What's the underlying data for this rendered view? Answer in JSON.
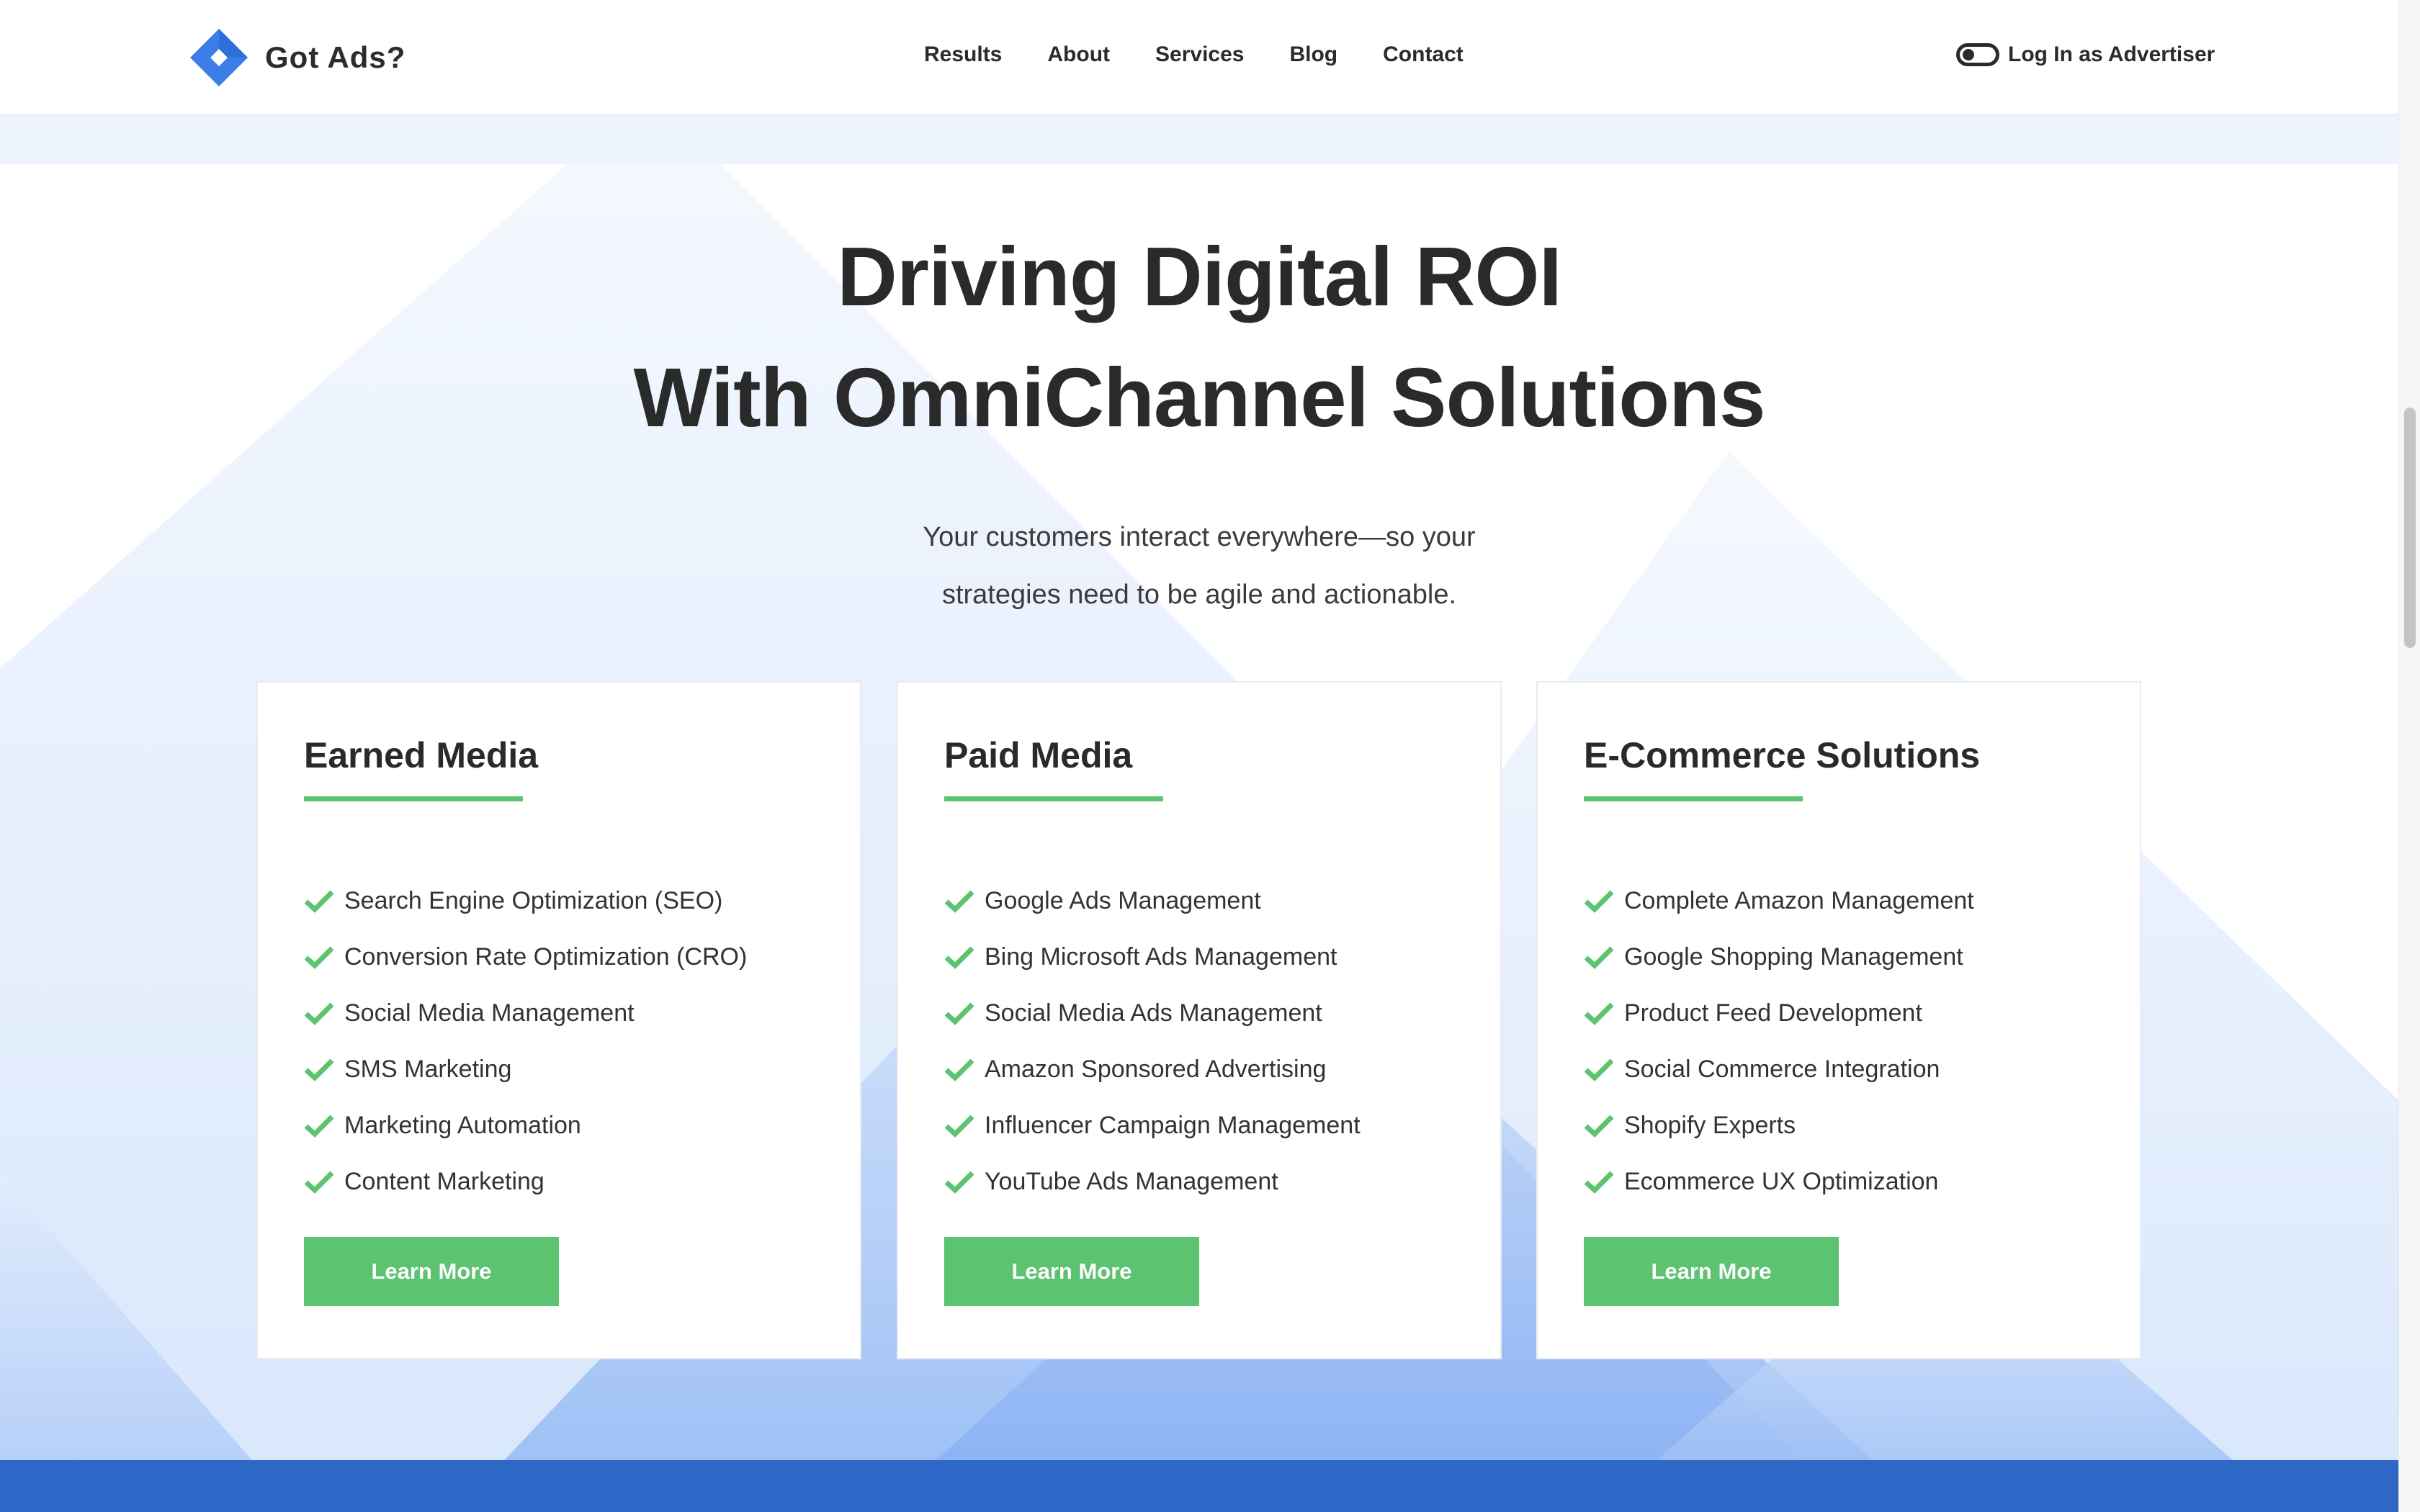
{
  "header": {
    "logo_text": "Got Ads?",
    "nav": [
      "Results",
      "About",
      "Services",
      "Blog",
      "Contact"
    ],
    "login_label": "Log In as Advertiser"
  },
  "hero": {
    "title_line1": "Driving Digital ROI",
    "title_line2": "With OmniChannel Solutions",
    "subtitle_line1": "Your customers interact everywhere—so your",
    "subtitle_line2": "strategies need to be agile and actionable."
  },
  "cards": [
    {
      "title": "Earned Media",
      "items": [
        "Search Engine Optimization (SEO)",
        "Conversion Rate Optimization (CRO)",
        "Social Media Management",
        "SMS Marketing",
        "Marketing Automation",
        "Content Marketing"
      ],
      "button": "Learn More"
    },
    {
      "title": "Paid Media",
      "items": [
        "Google Ads Management",
        "Bing Microsoft Ads Management",
        "Social Media Ads Management",
        "Amazon Sponsored Advertising",
        "Influencer Campaign Management",
        "YouTube Ads Management"
      ],
      "button": "Learn More"
    },
    {
      "title": "E-Commerce Solutions",
      "items": [
        "Complete Amazon Management",
        "Google Shopping Management",
        "Product Feed Development",
        "Social Commerce Integration",
        "Shopify Experts",
        "Ecommerce UX Optimization"
      ],
      "button": "Learn More"
    }
  ],
  "icons": {
    "logo": "diamond-logo-icon",
    "login": "toggle-icon",
    "list": "check-icon"
  },
  "colors": {
    "accent_green": "#5cc370",
    "brand_blue": "#3b7ee8",
    "bottom_band": "#2e67c6",
    "light_band": "#eef4fd"
  }
}
